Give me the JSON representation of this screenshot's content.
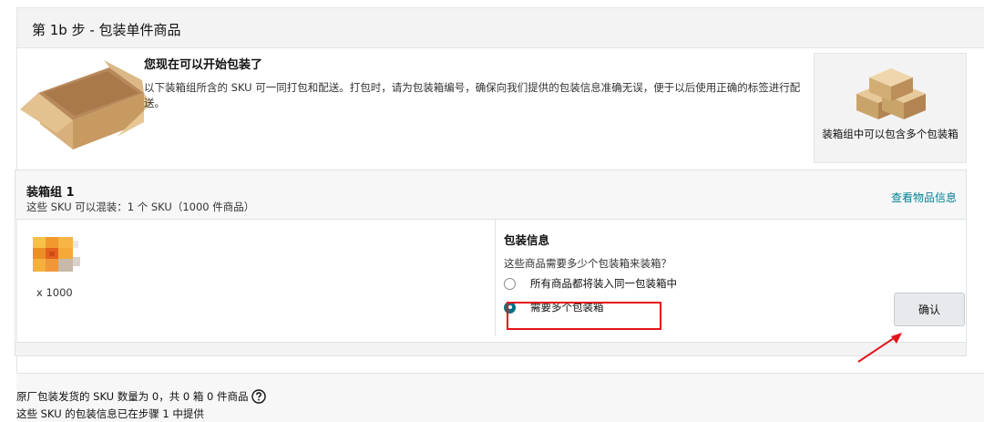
{
  "step": {
    "title": "第 1b 步 - 包装单件商品"
  },
  "intro": {
    "title": "您现在可以开始包装了",
    "text": "以下装箱组所含的 SKU 可一同打包和配送。打包时，请为包装箱编号，确保向我们提供的包装信息准确无误，便于以后使用正确的标签进行配送。",
    "box_icon": "open-cardboard-box-icon"
  },
  "multi_box_card": {
    "caption": "装箱组中可以包含多个包装箱",
    "icon": "stacked-boxes-icon"
  },
  "group": {
    "title": "装箱组 1",
    "subtitle": "这些 SKU 可以混装：1 个 SKU（1000 件商品）",
    "view_link": "查看物品信息",
    "sku": {
      "qty": "x 1000"
    },
    "packing": {
      "title": "包装信息",
      "question": "这些商品需要多少个包装箱来装箱？",
      "options": [
        {
          "label": "所有商品都将装入同一包装箱中",
          "selected": false
        },
        {
          "label": "需要多个包装箱",
          "selected": true
        }
      ],
      "confirm_label": "确认"
    }
  },
  "summary": {
    "line1": "原厂包装发货的 SKU 数量为 0，共 0 箱 0 件商品",
    "line2": "这些 SKU 的包装信息已在步骤 1 中提供"
  },
  "colors": {
    "accent": "#007185",
    "link": "#008296",
    "annotation": "#e4141b",
    "box_brown": "#c9a46a"
  }
}
